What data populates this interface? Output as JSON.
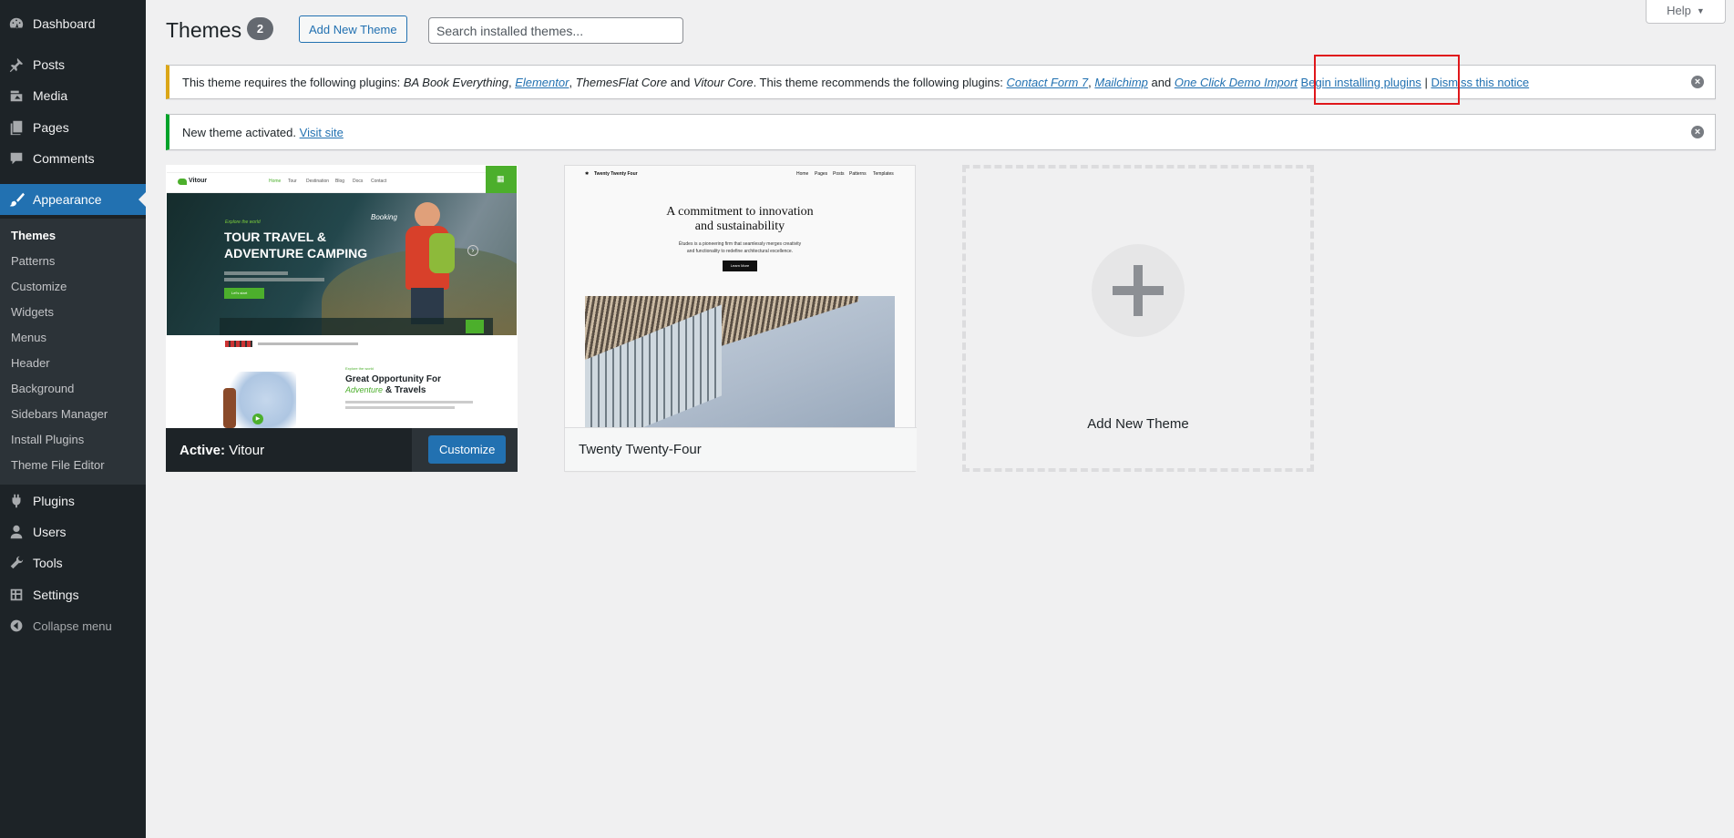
{
  "sidebar": {
    "items": [
      {
        "label": "Dashboard",
        "icon": "dashboard-icon"
      },
      {
        "label": "Posts",
        "icon": "pushpin-icon"
      },
      {
        "label": "Media",
        "icon": "media-icon"
      },
      {
        "label": "Pages",
        "icon": "pages-icon"
      },
      {
        "label": "Comments",
        "icon": "comments-icon"
      },
      {
        "label": "Appearance",
        "icon": "paintbrush-icon"
      },
      {
        "label": "Plugins",
        "icon": "plugins-icon"
      },
      {
        "label": "Users",
        "icon": "users-icon"
      },
      {
        "label": "Tools",
        "icon": "tools-icon"
      },
      {
        "label": "Settings",
        "icon": "settings-icon"
      }
    ],
    "submenu": [
      "Themes",
      "Patterns",
      "Customize",
      "Widgets",
      "Menus",
      "Header",
      "Background",
      "Sidebars Manager",
      "Install Plugins",
      "Theme File Editor"
    ],
    "collapse_label": "Collapse menu"
  },
  "header": {
    "title": "Themes",
    "count": "2",
    "add_new_label": "Add New Theme",
    "search_placeholder": "Search installed themes...",
    "help_label": "Help"
  },
  "notices": {
    "plugins": {
      "prefix": "This theme requires the following plugins:",
      "req1": "BA Book Everything",
      "req2": "Elementor",
      "req3": "ThemesFlat Core",
      "and1": "and",
      "req4": "Vitour Core",
      "mid": ". This theme recommends the following plugins:",
      "rec1": "Contact Form 7",
      "rec2": "Mailchimp",
      "and2": "and",
      "rec3": "One Click Demo Import",
      "begin": "Begin installing plugins",
      "sep": "|",
      "dismiss": "Dismiss this notice"
    },
    "activated": {
      "text": "New theme activated.",
      "link": "Visit site"
    }
  },
  "themes": {
    "active": {
      "active_prefix": "Active:",
      "name": "Vitour",
      "customize_label": "Customize",
      "shot": {
        "logo": "Vitour",
        "nav": [
          "Home",
          "Tour",
          "Destination",
          "Blog",
          "Docs",
          "Contact"
        ],
        "hero_small": "Explore the world",
        "hero_title1": "TOUR TRAVEL &",
        "hero_title2": "ADVENTURE CAMPING",
        "booking_script": "Booking",
        "cta": "Let's start",
        "lower_heading1": "Great Opportunity For",
        "lower_heading2_script": "Adventure",
        "lower_heading2": "& Travels",
        "lower_label": "Explore the world"
      }
    },
    "second": {
      "name": "Twenty Twenty-Four",
      "shot": {
        "site_title": "Twenty Twenty Four",
        "nav": [
          "Home",
          "Pages",
          "Posts",
          "Patterns",
          "Templates"
        ],
        "headline1": "A commitment to innovation",
        "headline2": "and sustainability",
        "body1": "Études is a pioneering firm that seamlessly merges creativity",
        "body2": "and functionality to redefine architectural excellence.",
        "button": "Learn More"
      }
    },
    "add_new": {
      "label": "Add New Theme"
    }
  },
  "colors": {
    "admin_bg": "#1d2327",
    "accent": "#2271b1",
    "warning": "#dba617",
    "success": "#00a32a",
    "highlight": "#e0171b"
  }
}
